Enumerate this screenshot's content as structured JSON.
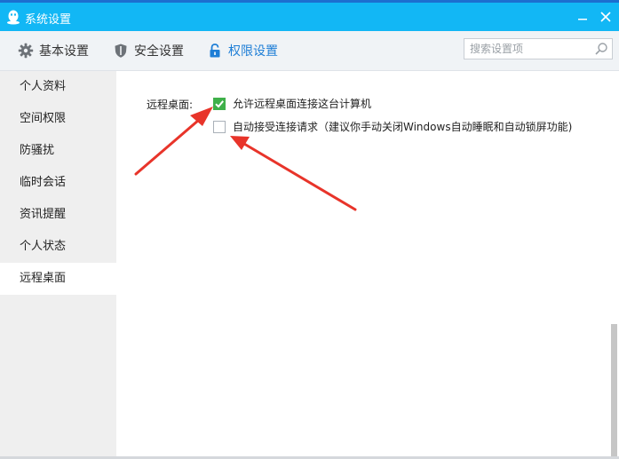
{
  "window": {
    "title": "系统设置",
    "icons": {
      "app": "qq-penguin-icon",
      "minimize": "minimize-icon",
      "close": "close-icon"
    }
  },
  "tabs": [
    {
      "label": "基本设置",
      "icon": "gear-icon",
      "active": false
    },
    {
      "label": "安全设置",
      "icon": "shield-icon",
      "active": false
    },
    {
      "label": "权限设置",
      "icon": "lock-icon",
      "active": true
    }
  ],
  "search": {
    "placeholder": "搜索设置项",
    "value": "",
    "icon": "search-icon"
  },
  "sidebar": {
    "items": [
      {
        "label": "个人资料",
        "active": false
      },
      {
        "label": "空间权限",
        "active": false
      },
      {
        "label": "防骚扰",
        "active": false
      },
      {
        "label": "临时会话",
        "active": false
      },
      {
        "label": "资讯提醒",
        "active": false
      },
      {
        "label": "个人状态",
        "active": false
      },
      {
        "label": "远程桌面",
        "active": true
      }
    ]
  },
  "remote_desktop": {
    "label": "远程桌面:",
    "options": [
      {
        "text": "允许远程桌面连接这台计算机",
        "checked": true
      },
      {
        "text": "自动接受连接请求（建议你手动关闭Windows自动睡眠和自动锁屏功能)",
        "checked": false
      }
    ]
  },
  "colors": {
    "titlebar": "#12b7f5",
    "active_tab": "#1e7ed6",
    "checkbox_checked": "#3fb04a",
    "annotation_arrow": "#e8342a"
  }
}
